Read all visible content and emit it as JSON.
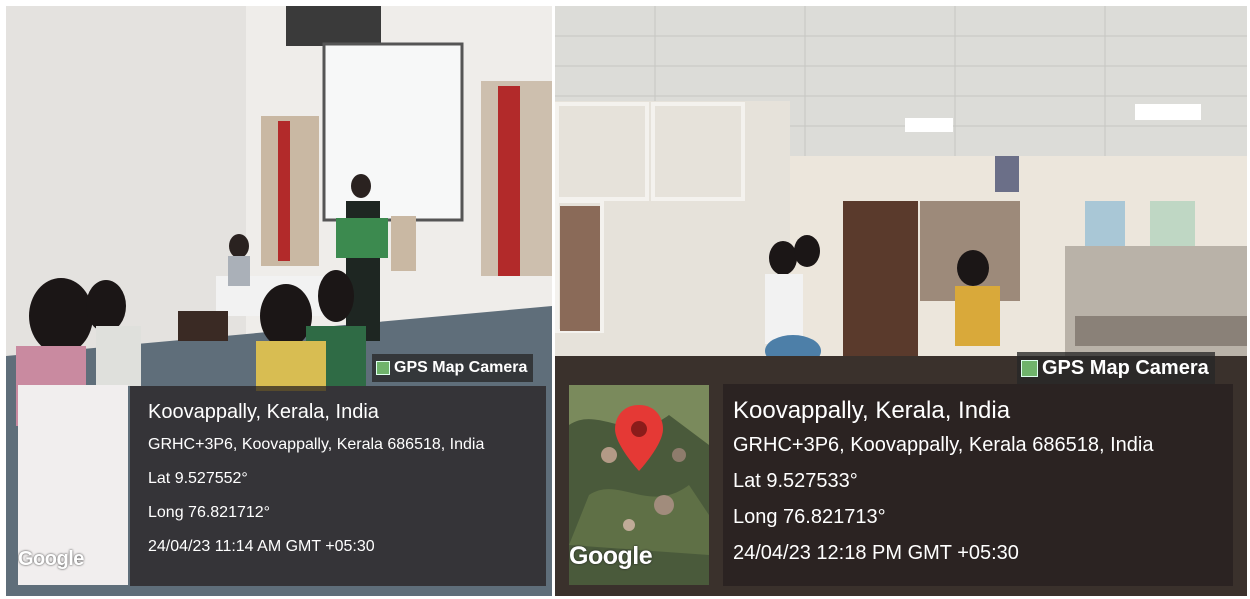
{
  "photos": [
    {
      "badge": "GPS Map Camera",
      "map_logo": "Google",
      "place": "Koovappally, Kerala, India",
      "address": "GRHC+3P6, Koovappally, Kerala 686518, India",
      "lat": "Lat 9.527552°",
      "long": "Long 76.821712°",
      "datetime": "24/04/23 11:14 AM GMT +05:30",
      "icons": [
        "gps-camera-icon"
      ]
    },
    {
      "badge": "GPS Map Camera",
      "map_logo": "Google",
      "place": "Koovappally, Kerala, India",
      "address": "GRHC+3P6, Koovappally, Kerala 686518, India",
      "lat": "Lat 9.527533°",
      "long": "Long 76.821713°",
      "datetime": "24/04/23 12:18 PM GMT +05:30",
      "icons": [
        "gps-camera-icon",
        "map-pin-icon"
      ]
    }
  ],
  "colors": {
    "pin": "#e53935",
    "overlay": "#262020"
  }
}
